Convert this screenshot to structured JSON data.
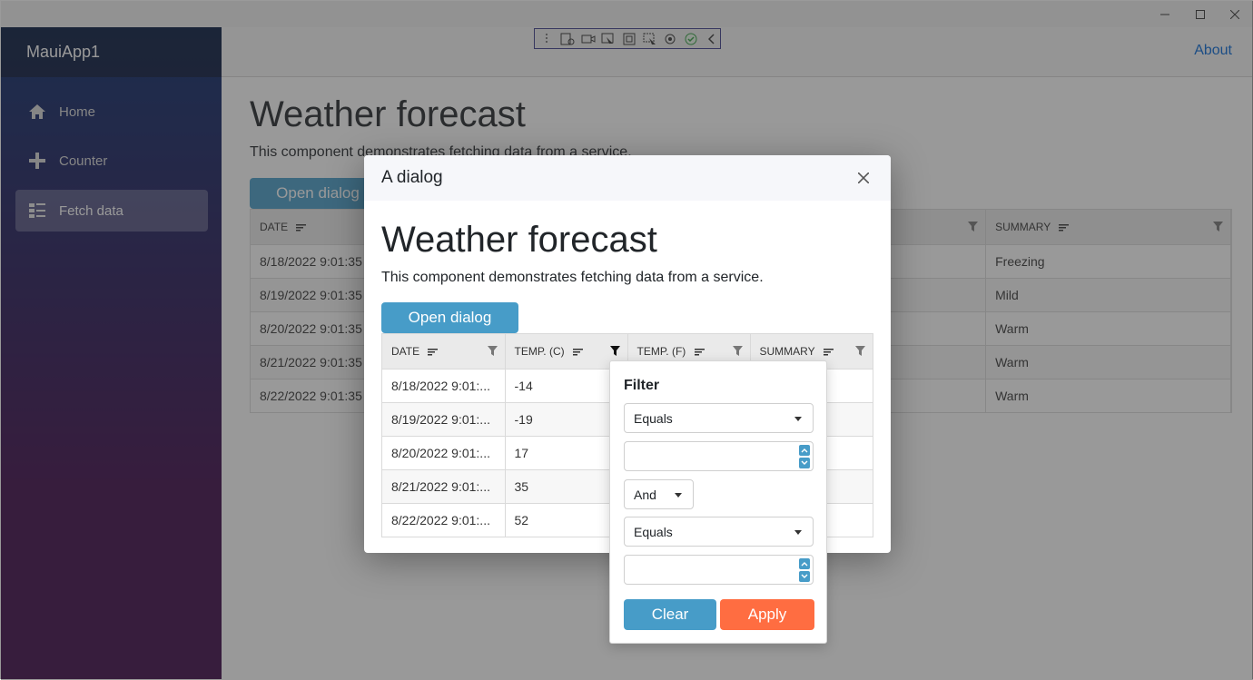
{
  "window": {
    "minimize_icon": "minimize-icon",
    "maximize_icon": "maximize-icon",
    "close_icon": "close-icon"
  },
  "sidebar": {
    "brand": "MauiApp1",
    "items": [
      {
        "label": "Home",
        "icon": "home-icon",
        "active": false
      },
      {
        "label": "Counter",
        "icon": "plus-icon",
        "active": false
      },
      {
        "label": "Fetch data",
        "icon": "list-icon",
        "active": true
      }
    ]
  },
  "topbar": {
    "about": "About"
  },
  "page": {
    "title": "Weather forecast",
    "description": "This component demonstrates fetching data from a service.",
    "open_dialog": "Open dialog",
    "grid": {
      "headers": [
        "DATE",
        "SUMMARY"
      ],
      "rows": [
        {
          "date": "8/18/2022 9:01:35 AM",
          "summary": "Freezing"
        },
        {
          "date": "8/19/2022 9:01:35 AM",
          "summary": "Mild"
        },
        {
          "date": "8/20/2022 9:01:35 AM",
          "summary": "Warm"
        },
        {
          "date": "8/21/2022 9:01:35 AM",
          "summary": "Warm"
        },
        {
          "date": "8/22/2022 9:01:35 AM",
          "summary": "Warm"
        }
      ]
    }
  },
  "dialog": {
    "title": "A dialog",
    "heading": "Weather forecast",
    "description": "This component demonstrates fetching data from a service.",
    "open_dialog": "Open dialog",
    "grid": {
      "headers": [
        "DATE",
        "TEMP. (C)",
        "TEMP. (F)",
        "SUMMARY"
      ],
      "rows": [
        {
          "date": "8/18/2022 9:01:...",
          "temp_c": "-14"
        },
        {
          "date": "8/19/2022 9:01:...",
          "temp_c": "-19"
        },
        {
          "date": "8/20/2022 9:01:...",
          "temp_c": "17"
        },
        {
          "date": "8/21/2022 9:01:...",
          "temp_c": "35"
        },
        {
          "date": "8/22/2022 9:01:...",
          "temp_c": "52"
        }
      ]
    }
  },
  "filter": {
    "title": "Filter",
    "operator1": "Equals",
    "value1": "",
    "logic": "And",
    "operator2": "Equals",
    "value2": "",
    "clear": "Clear",
    "apply": "Apply"
  },
  "colors": {
    "accent": "#479cc8",
    "apply": "#ff6d41",
    "link": "#0366d6"
  }
}
